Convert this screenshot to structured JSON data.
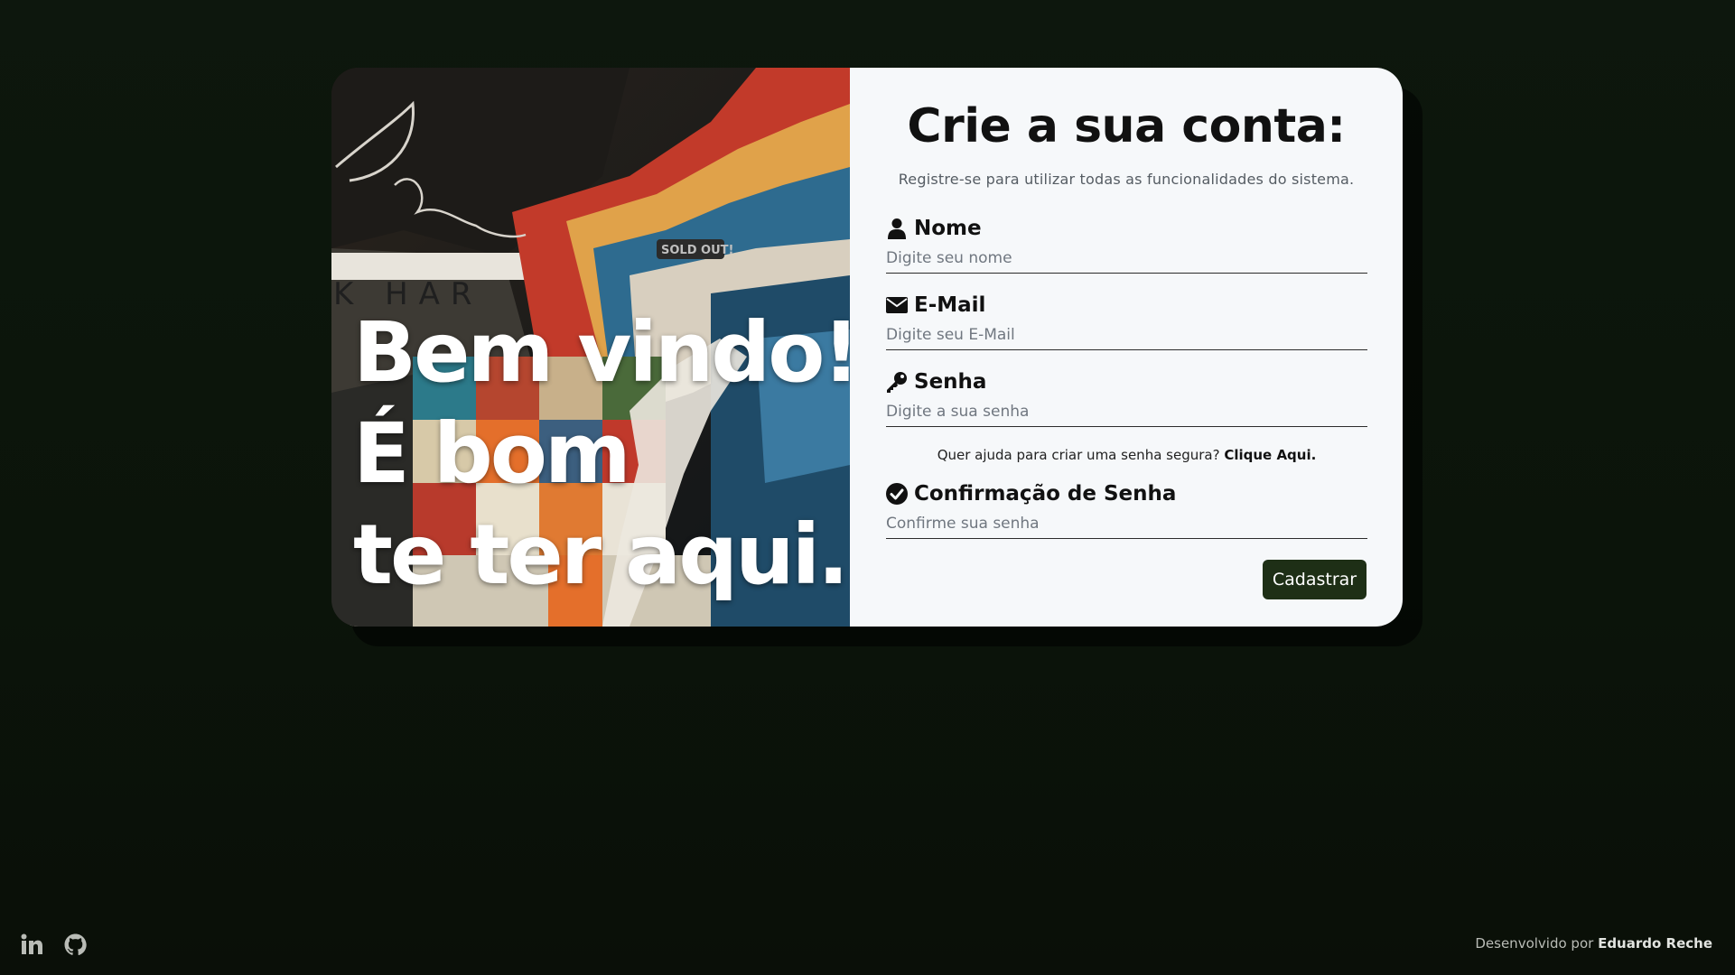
{
  "hero": {
    "line1": "Bem vindo!",
    "line2": "É bom",
    "line3": "te ter aqui."
  },
  "form": {
    "title": "Crie a sua conta:",
    "subtitle": "Registre-se para utilizar todas as funcionalidades do sistema.",
    "fields": [
      {
        "label": "Nome",
        "placeholder": "Digite seu nome",
        "icon": "user-icon"
      },
      {
        "label": "E-Mail",
        "placeholder": "Digite seu E-Mail",
        "icon": "envelope-icon"
      },
      {
        "label": "Senha",
        "placeholder": "Digite a sua senha",
        "icon": "key-icon"
      },
      {
        "label": "Confirmação de Senha",
        "placeholder": "Confirme sua senha",
        "icon": "check-circle-icon"
      }
    ],
    "help_text": "Quer ajuda para criar uma senha segura?",
    "help_link": "Clique Aqui.",
    "submit_label": "Cadastrar"
  },
  "footer": {
    "social": [
      "linkedin-icon",
      "github-icon"
    ],
    "credit_prefix": "Desenvolvido por",
    "credit_name": "Eduardo Reche"
  },
  "colors": {
    "page_bg": "#0d170d",
    "panel_bg": "#f6f8fa",
    "button_bg": "#1e2f16",
    "text": "#111111"
  }
}
